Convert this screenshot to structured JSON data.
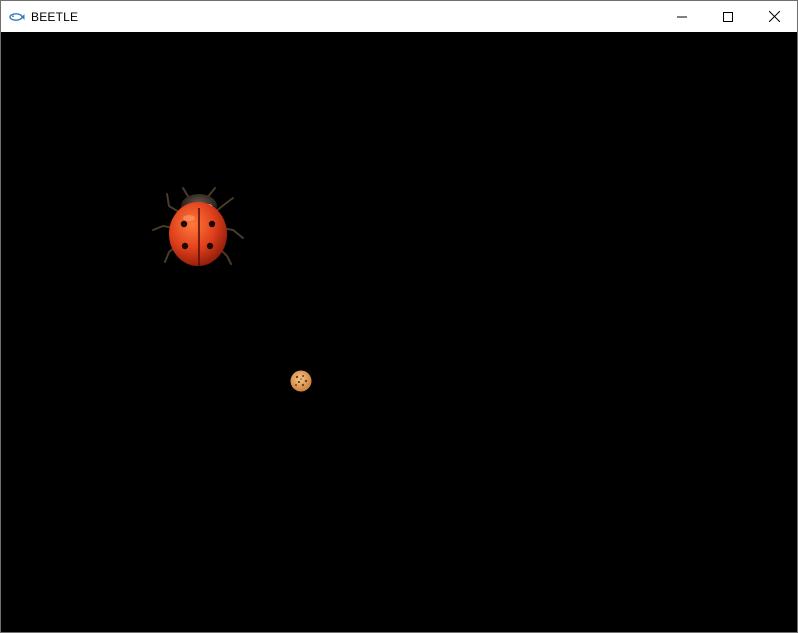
{
  "window": {
    "title": "BEETLE",
    "icon": "app-fish-icon",
    "controls": [
      "minimize-icon",
      "maximize-icon",
      "close-icon"
    ]
  },
  "game": {
    "background": "#000000",
    "sprites": [
      {
        "name": "ladybug",
        "icon": "ladybug-icon",
        "color": "#e0401c"
      },
      {
        "name": "cookie",
        "icon": "cookie-icon",
        "color": "#e8a35a"
      }
    ]
  }
}
